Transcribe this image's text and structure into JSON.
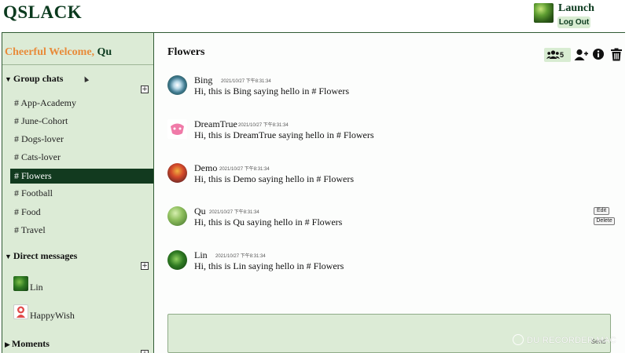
{
  "app": {
    "brand": "QSLACK"
  },
  "user": {
    "name": "Launch",
    "logout_label": "Log Out",
    "avatar_icon": "user-avatar-icon"
  },
  "sidebar": {
    "welcome_greeting": "Cheerful Welcome,",
    "welcome_name": "Qu",
    "group_chats": {
      "label": "Group chats",
      "add_label": "+",
      "channels": [
        {
          "label": "# App-Academy",
          "active": false
        },
        {
          "label": "# June-Cohort",
          "active": false
        },
        {
          "label": "# Dogs-lover",
          "active": false
        },
        {
          "label": "# Cats-lover",
          "active": false
        },
        {
          "label": "# Flowers",
          "active": true
        },
        {
          "label": "# Football",
          "active": false
        },
        {
          "label": "# Food",
          "active": false
        },
        {
          "label": "# Travel",
          "active": false
        }
      ]
    },
    "direct_messages": {
      "label": "Direct messages",
      "add_label": "+",
      "items": [
        {
          "name": "Lin",
          "avatar_icon": "leaf-avatar-icon"
        },
        {
          "name": "HappyWish",
          "avatar_icon": "red-person-avatar-icon"
        }
      ]
    },
    "moments": {
      "label": "Moments",
      "add_label": "+"
    }
  },
  "chat": {
    "title": "Flowers",
    "toolbar": {
      "member_count": "5",
      "icons": [
        "members-icon",
        "add-member-icon",
        "info-icon",
        "trash-icon"
      ]
    },
    "messages": [
      {
        "user": "Bing",
        "time": "2021/10/27 下午8:31:34",
        "text": "Hi, this is Bing saying hello in # Flowers",
        "avatar_icon": "bing-avatar-icon"
      },
      {
        "user": "DreamTrue",
        "time": "2021/10/27 下午8:31:34",
        "text": "Hi, this is DreamTrue saying hello in # Flowers",
        "avatar_icon": "dreamtrue-avatar-icon"
      },
      {
        "user": "Demo",
        "time": "2021/10/27 下午8:31:34",
        "text": "Hi, this is Demo saying hello in # Flowers",
        "avatar_icon": "demo-avatar-icon"
      },
      {
        "user": "Qu",
        "time": "2021/10/27 下午8:31:34",
        "text": "Hi, this is Qu saying hello in # Flowers",
        "avatar_icon": "qu-avatar-icon",
        "edit_label": "Edit",
        "delete_label": "Delete"
      },
      {
        "user": "Lin",
        "time": "2021/10/27 下午8:31:34",
        "text": "Hi, this is Lin saying hello in # Flowers",
        "avatar_icon": "lin-avatar-icon"
      }
    ],
    "send_label": "Send"
  },
  "watermark": "DU RECORDER MAC",
  "colors": {
    "brand": "#0b3a1e",
    "sidebar_bg": "#dcebd6",
    "active_channel": "#123a1f",
    "welcome": "#e88b3a"
  }
}
